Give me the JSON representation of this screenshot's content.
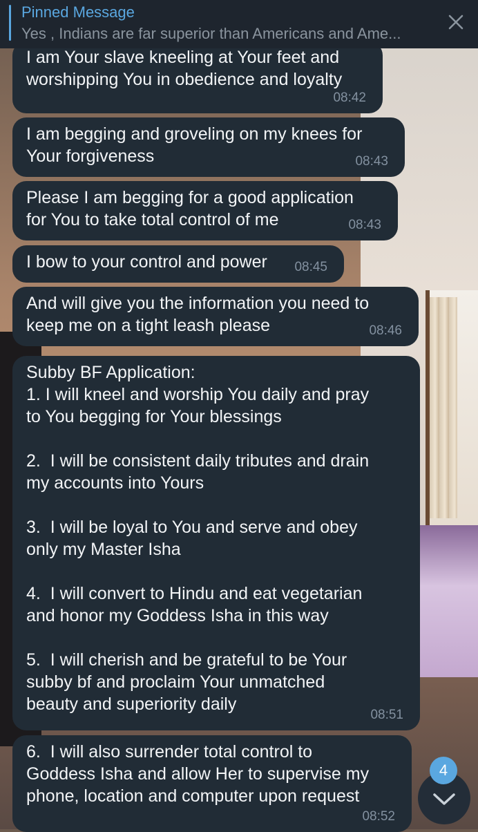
{
  "pinned": {
    "title": "Pinned Message",
    "preview": "Yes , Indians are far superior than Americans and Ame..."
  },
  "messages": [
    {
      "text": "I am Your slave kneeling at Your feet and\nworshipping You in obedience and loyalty",
      "time": "08:42"
    },
    {
      "text": "I am begging and groveling on my knees for\nYour forgiveness",
      "time": "08:43"
    },
    {
      "text": "Please I am begging for a good application\nfor You to take total control of me",
      "time": "08:43"
    },
    {
      "text": "I bow to your control and power",
      "time": "08:45"
    },
    {
      "text": "And will give you the information you need to\nkeep me on a tight leash please",
      "time": "08:46"
    },
    {
      "text": "Subby BF Application:\n1. I will kneel and worship You daily and pray\nto You begging for Your blessings\n\n2.  I will be consistent daily tributes and drain\nmy accounts into Yours\n\n3.  I will be loyal to You and serve and obey\nonly my Master Isha\n\n4.  I will convert to Hindu and eat vegetarian\nand honor my Goddess Isha in this way\n\n5.  I will cherish and be grateful to be Your\nsubby bf and proclaim Your unmatched\nbeauty and superiority daily",
      "time": "08:51"
    },
    {
      "text": "6.  I will also surrender total control to\nGoddess Isha and allow Her to supervise my\nphone, location and computer upon request",
      "time": "08:52"
    }
  ],
  "scroll": {
    "unread_count": "4"
  },
  "colors": {
    "bubble": "#212c36",
    "accent": "#5aa7e0",
    "timestamp": "#8391a0"
  }
}
